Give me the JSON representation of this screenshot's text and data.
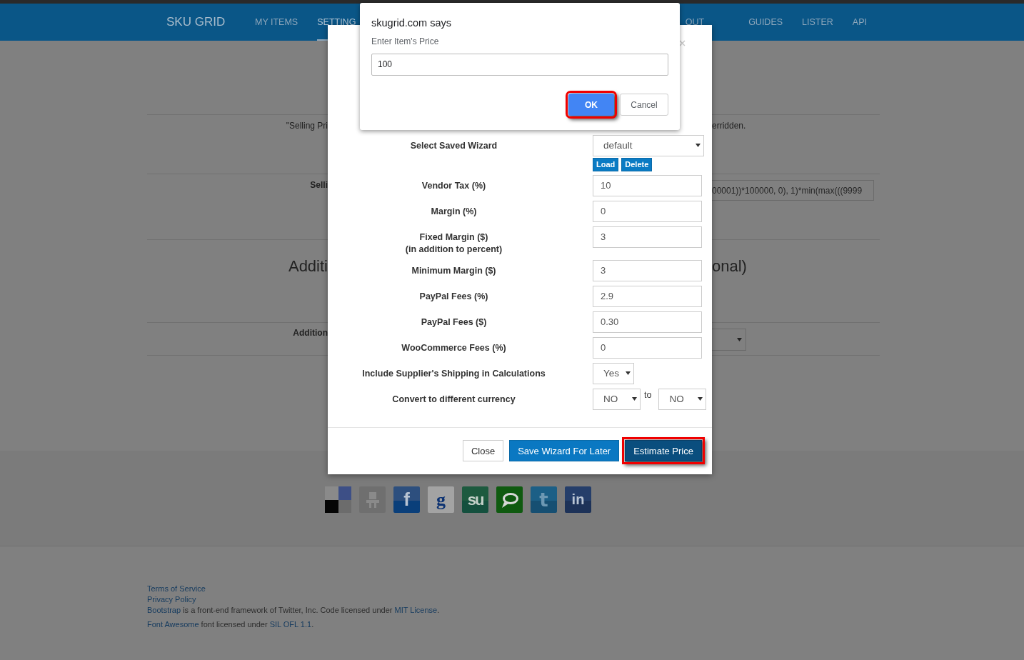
{
  "nav": {
    "brand": "SKU GRID",
    "left_items": [
      {
        "label": "MY ITEMS",
        "selected": false
      },
      {
        "label": "SETTING",
        "selected": true
      }
    ],
    "right_items": [
      {
        "label": "OUT",
        "selected": false
      },
      {
        "label": "GUIDES",
        "selected": false
      },
      {
        "label": "LISTER",
        "selected": false
      },
      {
        "label": "API",
        "selected": false
      }
    ]
  },
  "background": {
    "note_left": "\"Selling Pri",
    "note_right": "erridden.",
    "field_label": "Selli",
    "field_value": "00001))*100000, 0), 1)*min(max(((9999",
    "heading_left": "Additi",
    "heading_right": "onal)",
    "select_label": "Addition"
  },
  "alert": {
    "title": "skugrid.com says",
    "message": "Enter Item's Price",
    "value": "100",
    "buttons": [
      {
        "label": "OK",
        "kind": "primary",
        "highlighted": true
      },
      {
        "label": "Cancel",
        "kind": "secondary",
        "highlighted": false
      }
    ]
  },
  "wizard": {
    "rows": [
      {
        "label": "Select Saved Wizard",
        "kind": "select",
        "value": "default"
      },
      {
        "kind": "actions",
        "buttons": [
          "Load",
          "Delete"
        ]
      },
      {
        "label": "Vendor Tax (%)",
        "kind": "input",
        "value": "10"
      },
      {
        "label": "Margin (%)",
        "kind": "input",
        "value": "0"
      },
      {
        "label": "Fixed Margin ($)",
        "sublabel": "(in addition to percent)",
        "kind": "input",
        "value": "3"
      },
      {
        "label": "Minimum Margin ($)",
        "kind": "input",
        "value": "3"
      },
      {
        "label": "PayPal Fees (%)",
        "kind": "input",
        "value": "2.9"
      },
      {
        "label": "PayPal Fees ($)",
        "kind": "input",
        "value": "0.30"
      },
      {
        "label": "WooCommerce Fees (%)",
        "kind": "input",
        "value": "0"
      },
      {
        "label": "Include Supplier's Shipping in Calculations",
        "kind": "small_select",
        "value": "Yes"
      },
      {
        "label": "Convert to different currency",
        "kind": "select_pair",
        "value": "NO",
        "joiner": "to",
        "value2": "NO"
      }
    ],
    "buttons": [
      {
        "label": "Close",
        "kind": "default",
        "highlighted": false
      },
      {
        "label": "Save Wizard For Later",
        "kind": "primary",
        "highlighted": false
      },
      {
        "label": "Estimate Price",
        "kind": "dark",
        "highlighted": true
      }
    ]
  },
  "social": [
    {
      "kind": "delicious"
    },
    {
      "kind": "digg"
    },
    {
      "kind": "facebook",
      "glyph": "f"
    },
    {
      "kind": "google",
      "glyph": "g"
    },
    {
      "kind": "stumbleupon",
      "glyph": "su"
    },
    {
      "kind": "technorati"
    },
    {
      "kind": "twitter",
      "glyph": "t"
    },
    {
      "kind": "linkedin",
      "glyph": "in"
    }
  ],
  "footer": {
    "lines": [
      {
        "parts": [
          {
            "text": "Terms of Service",
            "kind": "link"
          }
        ]
      },
      {
        "parts": [
          {
            "text": "Privacy Policy",
            "kind": "link"
          }
        ]
      },
      {
        "parts": [
          {
            "text": "Bootstrap",
            "kind": "link"
          },
          {
            "text": " is a front-end framework of Twitter, Inc. Code licensed under ",
            "kind": "text"
          },
          {
            "text": "MIT License",
            "kind": "link"
          },
          {
            "text": ".",
            "kind": "text"
          }
        ]
      },
      {
        "parts": [
          {
            "text": "Font Awesome",
            "kind": "link"
          },
          {
            "text": " font licensed under ",
            "kind": "text"
          },
          {
            "text": "SIL OFL 1.1",
            "kind": "link"
          },
          {
            "text": ".",
            "kind": "text"
          }
        ]
      }
    ]
  }
}
